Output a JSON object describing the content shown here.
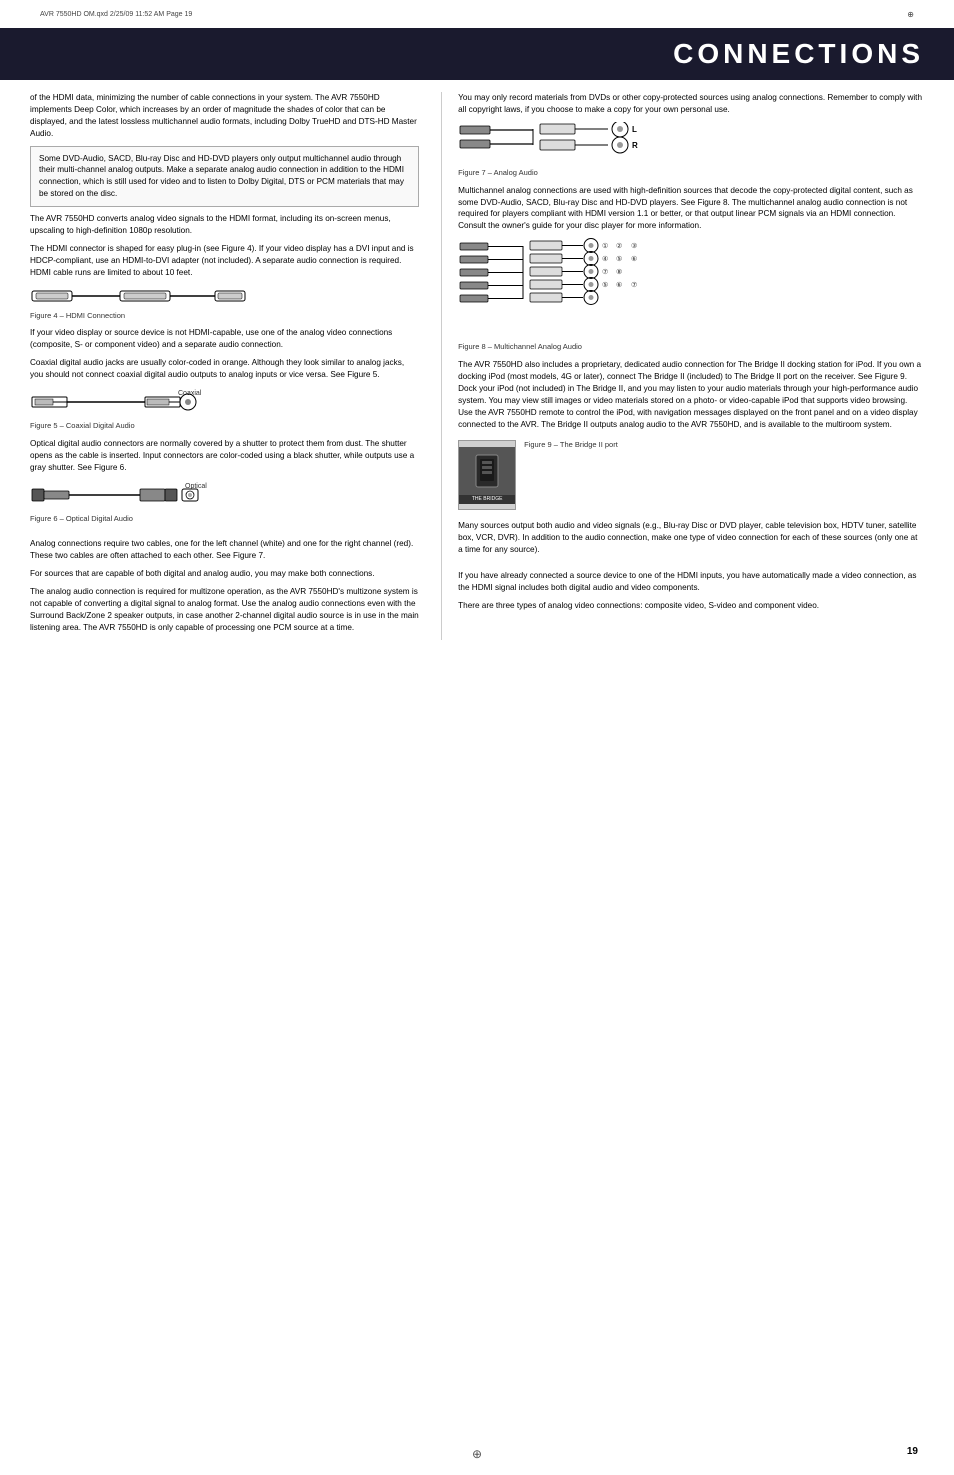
{
  "meta": {
    "crop_text": "AVR 7550HD OM.qxd   2/25/09   11:52 AM   Page 19",
    "page_number": "19"
  },
  "header": {
    "title": "CONNECTIONS"
  },
  "left_column": {
    "para1": "of the HDMI data, minimizing the number of cable connections in your system. The AVR 7550HD implements Deep Color, which increases by an order of magnitude the shades of color that can be displayed, and the latest lossless multichannel audio formats, including Dolby TrueHD and DTS-HD Master Audio.",
    "callout": "Some DVD-Audio, SACD, Blu-ray Disc and HD-DVD players only output multichannel audio through their multi-channel analog outputs. Make a separate analog audio connection in addition to the HDMI connection, which is still used for video and to listen to Dolby Digital, DTS or PCM materials that may be stored on the disc.",
    "para2": "The AVR 7550HD converts analog video signals to the HDMI format, including its on-screen menus, upscaling to high-definition 1080p resolution.",
    "para3": "The HDMI connector is shaped for easy plug-in (see Figure 4). If your video display has a DVI input and is HDCP-compliant, use an HDMI-to-DVI adapter (not included). A separate audio connection is required. HDMI cable runs are limited to about 10 feet.",
    "fig4_caption": "Figure 4 – HDMI Connection",
    "para4": "If your video display or source device is not HDMI-capable, use one of the analog video connections (composite, S- or component video) and a separate audio connection.",
    "para5": "Coaxial digital audio jacks are usually color-coded in orange. Although they look similar to analog jacks, you should not connect coaxial digital audio outputs to analog inputs or vice versa. See Figure 5.",
    "fig5_label": "Coaxial",
    "fig5_caption": "Figure 5 – Coaxial Digital Audio",
    "para6": "Optical digital audio connectors are normally covered by a shutter to protect them from dust. The shutter opens as the cable is inserted. Input connectors are color-coded using a black shutter, while outputs use a gray shutter. See Figure 6.",
    "fig6_label": "Optical",
    "fig6_caption": "Figure 6 – Optical Digital Audio",
    "para7": "Analog connections require two cables, one for the left channel (white) and one for the right channel (red). These two cables are often attached to each other. See Figure 7.",
    "para8": "For sources that are capable of both digital and analog audio, you may make both connections.",
    "para9": "The analog audio connection is required for multizone operation, as the AVR 7550HD's multizone system is not capable of converting a digital signal to analog format. Use the analog audio connections even with the Surround Back/Zone 2 speaker outputs, in case another 2-channel digital audio source is in use in the main listening area. The AVR 7550HD is only capable of processing one PCM source at a time."
  },
  "right_column": {
    "para1": "You may only record materials from DVDs or other copy-protected sources using analog connections. Remember to comply with all copyright laws, if you choose to make a copy for your own personal use.",
    "fig7_caption": "Figure 7 – Analog Audio",
    "fig7_label_L": "L",
    "fig7_label_R": "R",
    "para2": "Multichannel analog connections are used with high-definition sources that decode the copy-protected digital content, such as some DVD-Audio, SACD, Blu-ray Disc and HD-DVD players. See Figure 8. The multichannel analog audio connection is not required for players compliant with HDMI version 1.1 or better, or that output linear PCM signals via an HDMI connection. Consult the owner's guide for your disc player for more information.",
    "fig8_caption": "Figure 8 – Multichannel Analog Audio",
    "para3": "The AVR 7550HD also includes a proprietary, dedicated audio connection for The Bridge II docking station for iPod. If you own a docking iPod (most models, 4G or later), connect The Bridge II (included) to The Bridge II port on the receiver. See Figure 9. Dock your iPod (not included) in The Bridge II, and you may listen to your audio materials through your high-performance audio system. You may view still images or video materials stored on a photo- or video-capable iPod that supports video browsing. Use the AVR 7550HD remote to control the iPod, with navigation messages displayed on the front panel and on a video display connected to the AVR. The Bridge II outputs analog audio to the AVR 7550HD, and is available to the multiroom system.",
    "fig9_caption": "Figure 9 – The Bridge II port",
    "bridge_label": "THE BRIDGE",
    "para4": "Many sources output both audio and video signals (e.g., Blu-ray Disc or DVD player, cable television box, HDTV tuner, satellite box, VCR, DVR). In addition to the audio connection, make one type of video connection for each of these sources (only one at a time for any source).",
    "para5": "If you have already connected a source device to one of the HDMI inputs, you have automatically made a video connection, as the HDMI signal includes both digital audio and video components.",
    "para6": "There are three types of analog video connections: composite video, S-video and component video."
  }
}
